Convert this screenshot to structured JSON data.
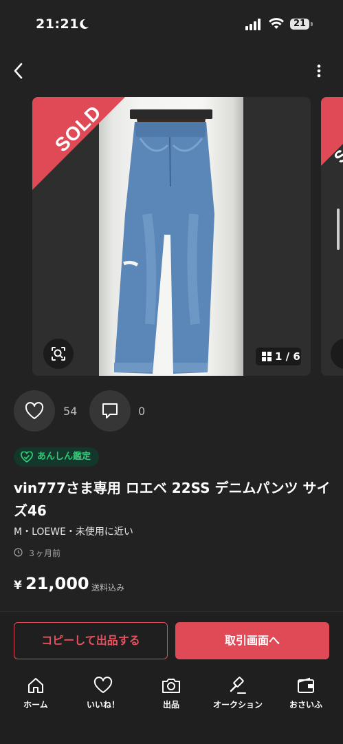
{
  "status_bar": {
    "time": "21:21",
    "battery": "21"
  },
  "carousel": {
    "sold_label": "SOLD",
    "counter": "1 / 6"
  },
  "engagement": {
    "likes": "54",
    "comments": "0"
  },
  "item": {
    "badge": "あんしん鑑定",
    "title": "vin777さま専用 ロエベ 22SS デニムパンツ サイズ46",
    "meta": "M・LOEWE・未使用に近い",
    "posted": "３ヶ月前",
    "currency": "¥",
    "price": "21,000",
    "shipping_note": "送料込み"
  },
  "actions": {
    "copy_label": "コピーして出品する",
    "trade_label": "取引画面へ"
  },
  "tab_bar": {
    "items": [
      {
        "label": "ホーム",
        "icon": "home-icon"
      },
      {
        "label": "いいね！",
        "icon": "heart-icon"
      },
      {
        "label": "出品",
        "icon": "camera-icon"
      },
      {
        "label": "オークション",
        "icon": "gavel-icon"
      },
      {
        "label": "おさいふ",
        "icon": "wallet-icon"
      }
    ]
  },
  "colors": {
    "accent": "#e04a57",
    "background": "#222222",
    "badge_green": "#35c77a",
    "denim": "#5a86b8"
  }
}
